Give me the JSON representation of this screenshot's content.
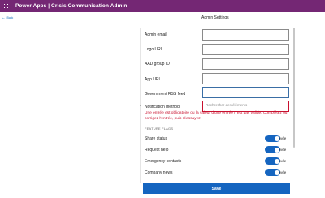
{
  "header": {
    "title": "Power Apps  |  Crisis Communication Admin"
  },
  "nav": {
    "back_label": "Back",
    "back_icon": "arrow-left-icon"
  },
  "page": {
    "title": "Admin Settings"
  },
  "form": {
    "fields": [
      {
        "label": "Admin email",
        "value": ""
      },
      {
        "label": "Logo URL",
        "value": ""
      },
      {
        "label": "AAD group ID",
        "value": ""
      },
      {
        "label": "App URL",
        "value": ""
      },
      {
        "label": "Government RSS feed",
        "value": ""
      }
    ],
    "notification": {
      "required_marker": "*",
      "label": "Notification method",
      "placeholder": "Rechercher des éléments"
    },
    "error_message": "Une entrée est obligatoire ou la valeur d'une entrée n'est pas valide. Complétez ou corrigez l'entrée, puis réessayez."
  },
  "feature_flags": {
    "section_label": "FEATURE FLAGS",
    "items": [
      {
        "label": "Share status",
        "toggle_text": "ivée",
        "on": true
      },
      {
        "label": "Request help",
        "toggle_text": "ivée",
        "on": true
      },
      {
        "label": "Emergency contacts",
        "toggle_text": "ivée",
        "on": true
      },
      {
        "label": "Company news",
        "toggle_text": "ivée",
        "on": true
      }
    ]
  },
  "actions": {
    "save_label": "Save"
  },
  "colors": {
    "header": "#742774",
    "accent": "#1565c0",
    "error": "#c8102e"
  }
}
